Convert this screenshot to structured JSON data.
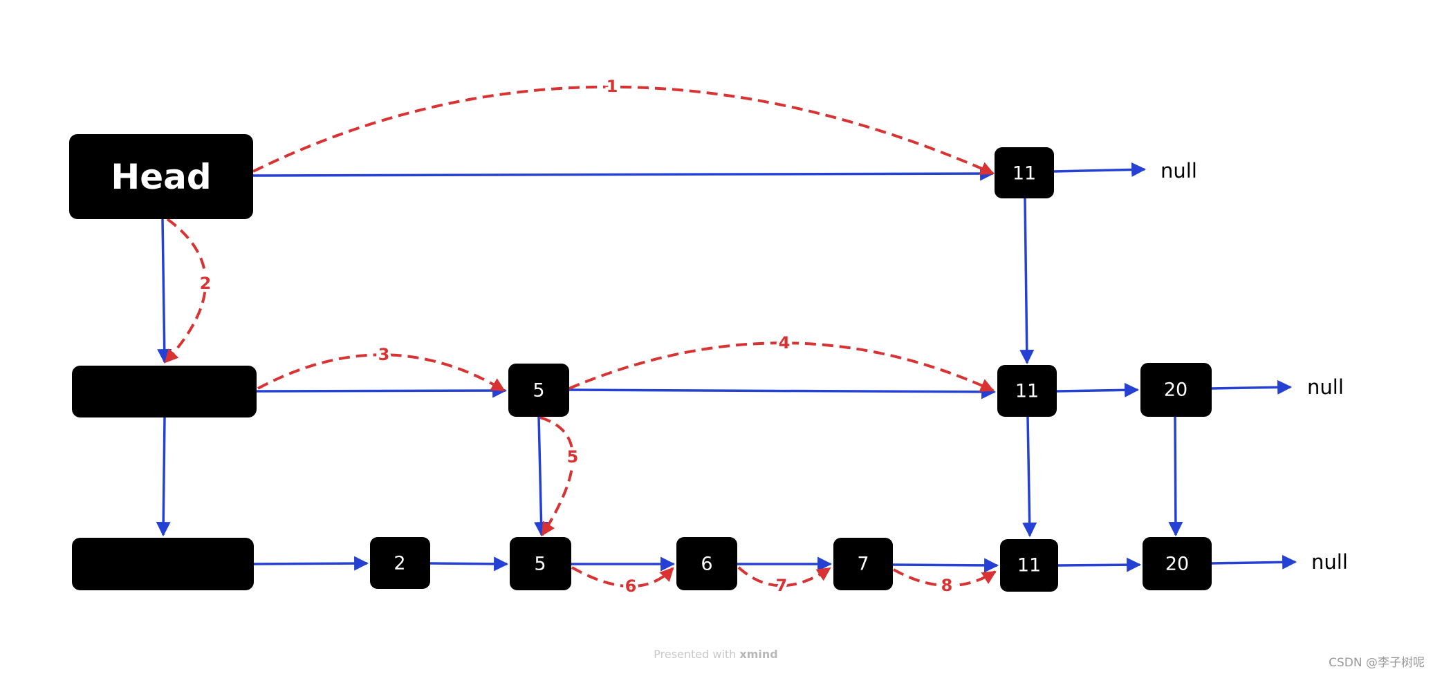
{
  "nodes": {
    "head": "Head",
    "r1_11": "11",
    "r2_5": "5",
    "r2_11": "11",
    "r2_20": "20",
    "r3_2": "2",
    "r3_5": "5",
    "r3_6": "6",
    "r3_7": "7",
    "r3_11": "11",
    "r3_20": "20"
  },
  "null_labels": [
    "null",
    "null",
    "null"
  ],
  "steps": [
    "1",
    "2",
    "3",
    "4",
    "5",
    "6",
    "7",
    "8"
  ],
  "footer": {
    "prefix": "Presented with ",
    "brand": "xmind"
  },
  "watermark": "CSDN @李子树呢",
  "colors": {
    "link": "#2441d4",
    "search_path": "#d83232",
    "node": "#000000"
  }
}
